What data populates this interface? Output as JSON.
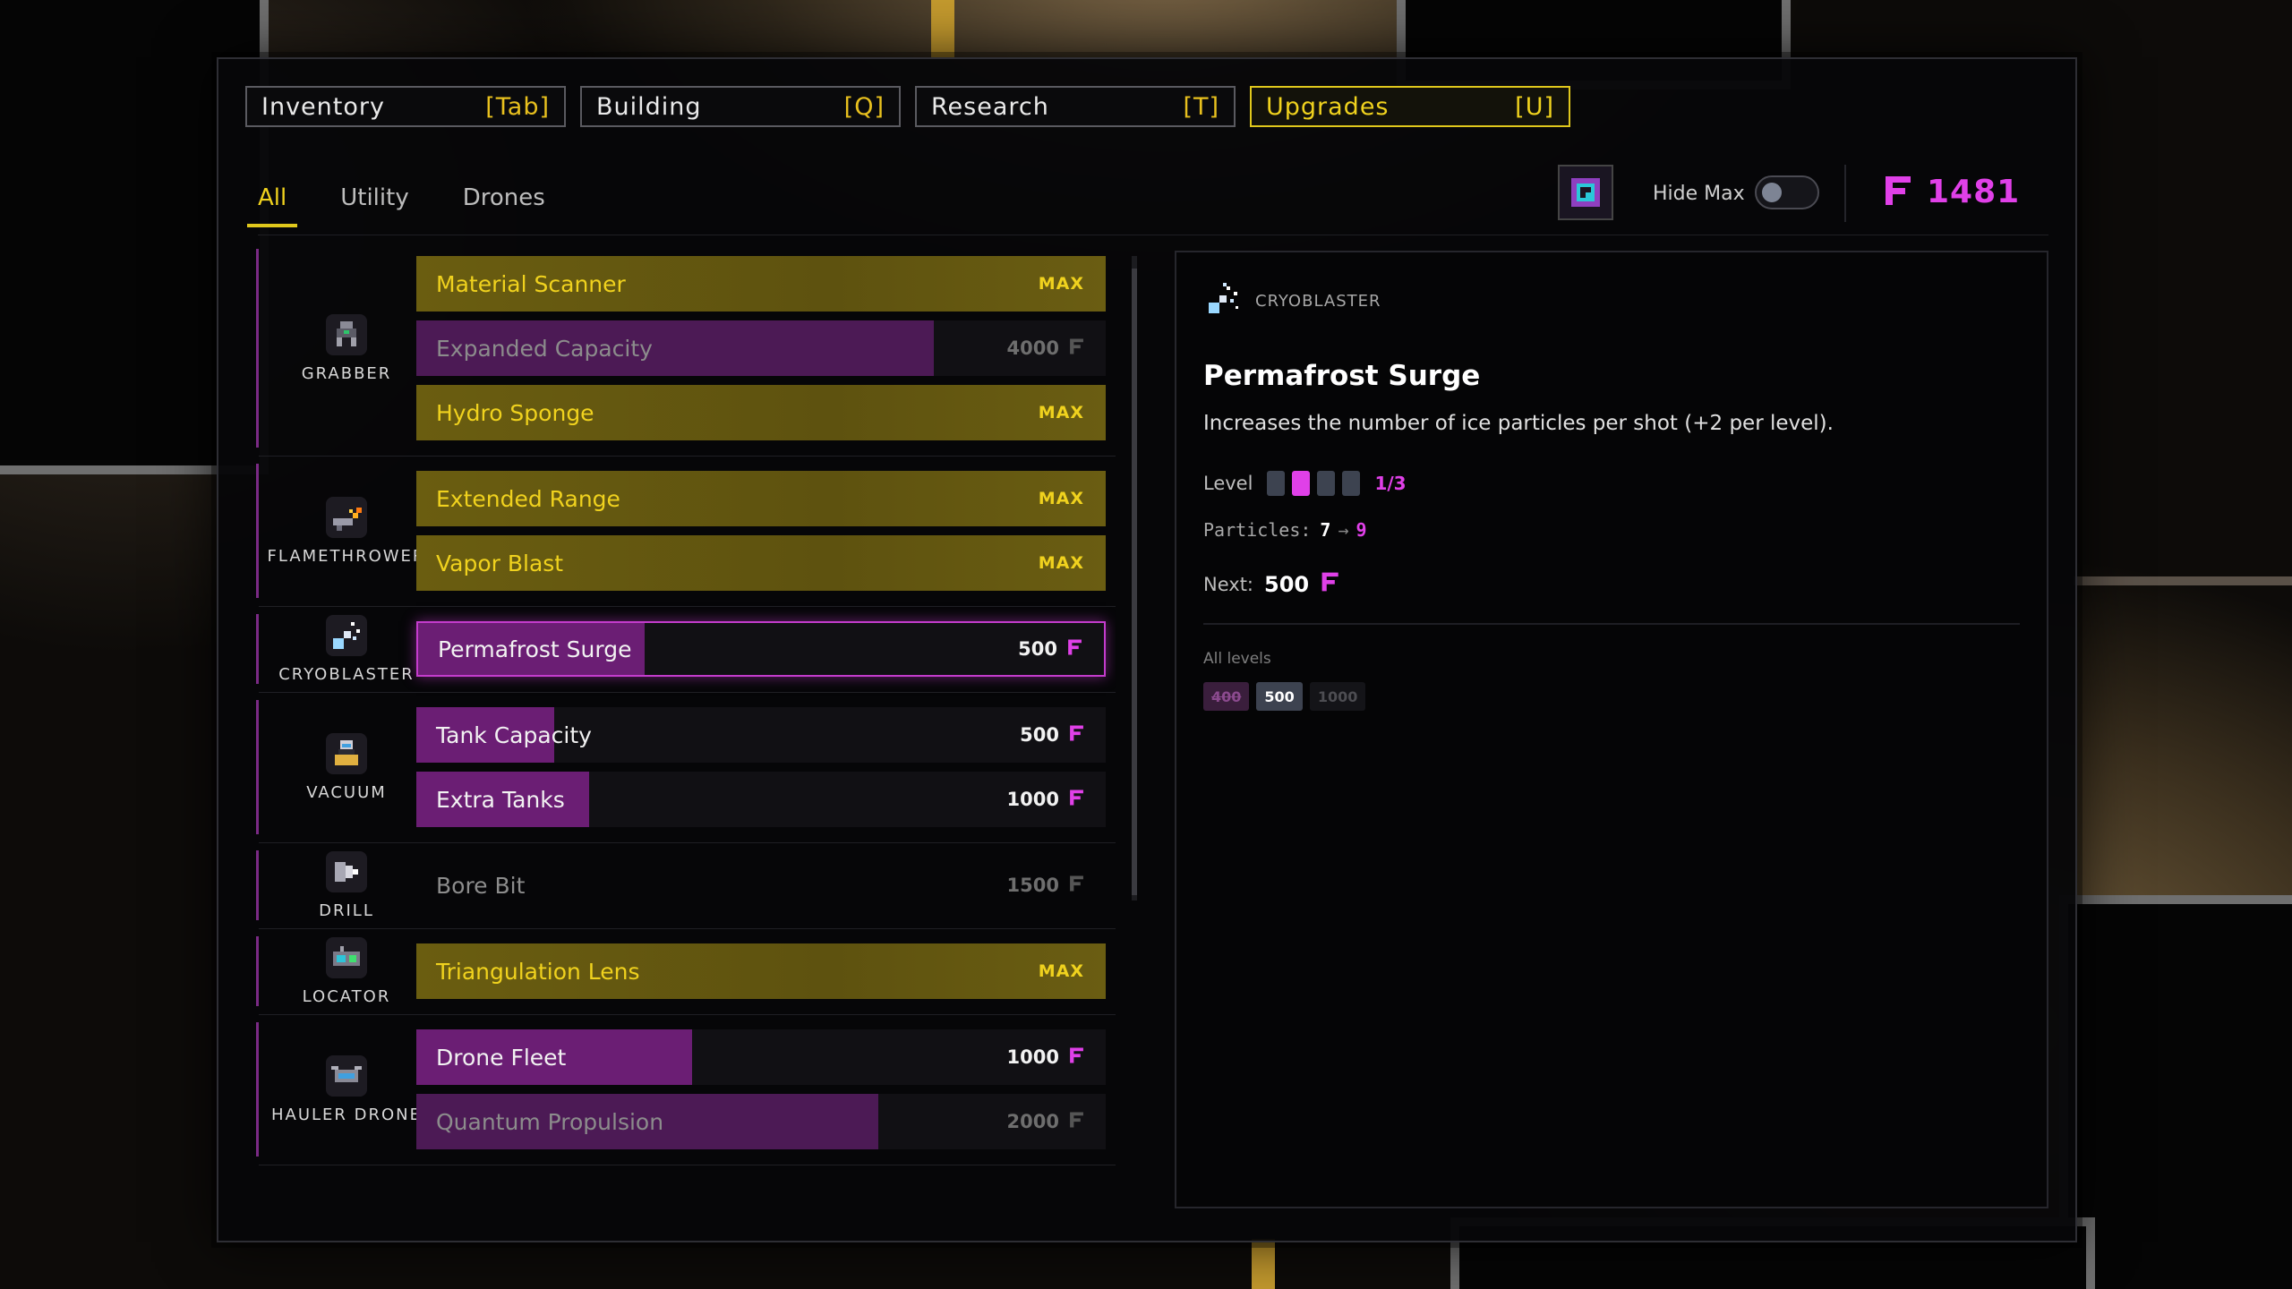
{
  "colors": {
    "accent_yellow": "#f0d21e",
    "accent_magenta": "#e040e8",
    "fill_magenta": "#6b1e74",
    "max_row": "#5e520f"
  },
  "top_tabs": [
    {
      "label": "Inventory",
      "hotkey": "[Tab]"
    },
    {
      "label": "Building",
      "hotkey": "[Q]"
    },
    {
      "label": "Research",
      "hotkey": "[T]"
    },
    {
      "label": "Upgrades",
      "hotkey": "[U]"
    }
  ],
  "sub_tabs": [
    "All",
    "Utility",
    "Drones"
  ],
  "header": {
    "hide_max_label": "Hide Max",
    "hide_max_on": false,
    "currency_amount": "1481",
    "currency_icon": "f-currency-icon"
  },
  "groups": [
    {
      "category": "GRABBER",
      "icon": "grabber-icon",
      "upgrades": [
        {
          "name": "Material Scanner",
          "price": "MAX",
          "state": "max",
          "progress": 1.0
        },
        {
          "name": "Expanded Capacity",
          "price": "4000",
          "state": "locked",
          "progress": 0.75
        },
        {
          "name": "Hydro Sponge",
          "price": "MAX",
          "state": "max",
          "progress": 1.0
        }
      ]
    },
    {
      "category": "FLAMETHROWER",
      "icon": "flamethrower-icon",
      "upgrades": [
        {
          "name": "Extended Range",
          "price": "MAX",
          "state": "max",
          "progress": 1.0
        },
        {
          "name": "Vapor Blast",
          "price": "MAX",
          "state": "max",
          "progress": 1.0
        }
      ]
    },
    {
      "category": "CRYOBLASTER",
      "icon": "cryoblaster-icon",
      "upgrades": [
        {
          "name": "Permafrost Surge",
          "price": "500",
          "state": "selected",
          "progress": 0.33
        }
      ]
    },
    {
      "category": "VACUUM",
      "icon": "vacuum-icon",
      "upgrades": [
        {
          "name": "Tank Capacity",
          "price": "500",
          "state": "available",
          "progress": 0.2
        },
        {
          "name": "Extra Tanks",
          "price": "1000",
          "state": "available",
          "progress": 0.25
        }
      ]
    },
    {
      "category": "DRILL",
      "icon": "drill-icon",
      "upgrades": [
        {
          "name": "Bore Bit",
          "price": "1500",
          "state": "locked",
          "progress": 0
        }
      ]
    },
    {
      "category": "LOCATOR",
      "icon": "locator-icon",
      "upgrades": [
        {
          "name": "Triangulation Lens",
          "price": "MAX",
          "state": "max",
          "progress": 1.0
        }
      ]
    },
    {
      "category": "HAULER DRONE",
      "icon": "hauler-drone-icon",
      "upgrades": [
        {
          "name": "Drone Fleet",
          "price": "1000",
          "state": "available",
          "progress": 0.4
        },
        {
          "name": "Quantum Propulsion",
          "price": "2000",
          "state": "locked",
          "progress": 0.67
        }
      ]
    }
  ],
  "detail": {
    "category": "CRYOBLASTER",
    "title": "Permafrost Surge",
    "description": "Increases the number of ice particles per shot (+2 per level).",
    "level_label": "Level",
    "level_current": 1,
    "level_max": 3,
    "level_text": "1/3",
    "stat_label": "Particles:",
    "stat_from": "7",
    "stat_arrow": "→",
    "stat_to": "9",
    "next_label": "Next:",
    "next_price": "500",
    "all_levels_label": "All levels",
    "all_levels": [
      {
        "price": "400",
        "state": "done"
      },
      {
        "price": "500",
        "state": "current"
      },
      {
        "price": "1000",
        "state": "future"
      }
    ]
  }
}
